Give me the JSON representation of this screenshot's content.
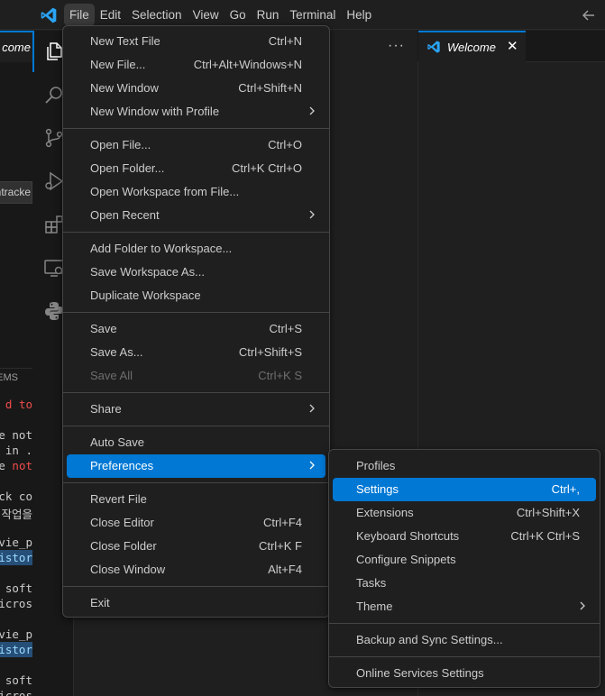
{
  "menubar": {
    "items": [
      "File",
      "Edit",
      "Selection",
      "View",
      "Go",
      "Run",
      "Terminal",
      "Help"
    ]
  },
  "left_panel": {
    "tab_fragment": "come",
    "input_fragment": "ntracke",
    "problems_fragment": "EMS",
    "terminal_lines": [
      {
        "text": "d to",
        "style": "red"
      },
      {
        "text": "e not",
        "style": "normal"
      },
      {
        "text": " in .",
        "style": "normal"
      },
      {
        "text": "e not",
        "style": "mixed"
      },
      {
        "text": "ck co",
        "style": "normal"
      },
      {
        "text": "작업을",
        "style": "normal"
      },
      {
        "text": "vie_p",
        "style": "normal"
      },
      {
        "text": "istor",
        "style": "highlight"
      },
      {
        "text": "soft",
        "style": "normal"
      },
      {
        "text": "icros",
        "style": "normal"
      },
      {
        "text": "vie_p",
        "style": "normal"
      },
      {
        "text": "istor",
        "style": "highlight"
      },
      {
        "text": "soft",
        "style": "normal"
      },
      {
        "text": "icros",
        "style": "normal"
      }
    ]
  },
  "editor": {
    "more_actions": "···",
    "welcome_tab": "Welcome",
    "close_glyph": "✕"
  },
  "file_menu": {
    "groups": [
      [
        {
          "label": "New Text File",
          "shortcut": "Ctrl+N"
        },
        {
          "label": "New File...",
          "shortcut": "Ctrl+Alt+Windows+N"
        },
        {
          "label": "New Window",
          "shortcut": "Ctrl+Shift+N"
        },
        {
          "label": "New Window with Profile",
          "submenu": true
        }
      ],
      [
        {
          "label": "Open File...",
          "shortcut": "Ctrl+O"
        },
        {
          "label": "Open Folder...",
          "shortcut": "Ctrl+K Ctrl+O"
        },
        {
          "label": "Open Workspace from File..."
        },
        {
          "label": "Open Recent",
          "submenu": true
        }
      ],
      [
        {
          "label": "Add Folder to Workspace..."
        },
        {
          "label": "Save Workspace As..."
        },
        {
          "label": "Duplicate Workspace"
        }
      ],
      [
        {
          "label": "Save",
          "shortcut": "Ctrl+S"
        },
        {
          "label": "Save As...",
          "shortcut": "Ctrl+Shift+S"
        },
        {
          "label": "Save All",
          "shortcut": "Ctrl+K S",
          "disabled": true
        }
      ],
      [
        {
          "label": "Share",
          "submenu": true
        }
      ],
      [
        {
          "label": "Auto Save"
        },
        {
          "label": "Preferences",
          "submenu": true,
          "selected": true
        }
      ],
      [
        {
          "label": "Revert File"
        },
        {
          "label": "Close Editor",
          "shortcut": "Ctrl+F4"
        },
        {
          "label": "Close Folder",
          "shortcut": "Ctrl+K F"
        },
        {
          "label": "Close Window",
          "shortcut": "Alt+F4"
        }
      ],
      [
        {
          "label": "Exit"
        }
      ]
    ]
  },
  "preferences_menu": {
    "groups": [
      [
        {
          "label": "Profiles"
        },
        {
          "label": "Settings",
          "shortcut": "Ctrl+,",
          "selected": true
        },
        {
          "label": "Extensions",
          "shortcut": "Ctrl+Shift+X"
        },
        {
          "label": "Keyboard Shortcuts",
          "shortcut": "Ctrl+K Ctrl+S"
        },
        {
          "label": "Configure Snippets"
        },
        {
          "label": "Tasks"
        },
        {
          "label": "Theme",
          "submenu": true
        }
      ],
      [
        {
          "label": "Backup and Sync Settings..."
        }
      ],
      [
        {
          "label": "Online Services Settings"
        }
      ]
    ]
  },
  "colors": {
    "accent": "#0078d4",
    "background": "#1f1f1f",
    "terminal_error": "#f14c4c"
  }
}
